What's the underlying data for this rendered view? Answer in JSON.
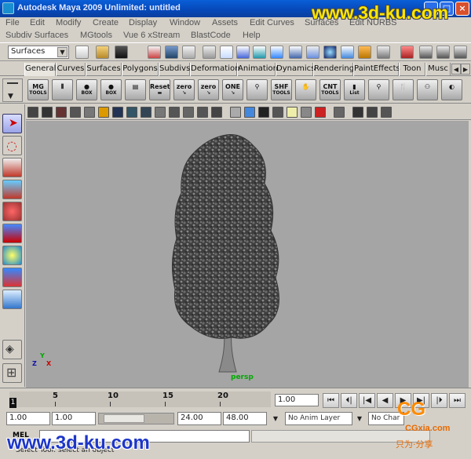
{
  "window": {
    "title": "Autodesk Maya 2009 Unlimited: untitled",
    "minimize": "_",
    "maximize": "□",
    "close": "×"
  },
  "menus": {
    "row1": [
      "File",
      "Edit",
      "Modify",
      "Create",
      "Display",
      "Window",
      "Assets",
      "Edit Curves",
      "Surfaces",
      "Edit NURBS"
    ],
    "row2": [
      "Subdiv Surfaces",
      "MGtools",
      "Vue 6 xStream",
      "BlastCode",
      "Help"
    ]
  },
  "toolbar": {
    "mode_selector": "Surfaces"
  },
  "shelf": {
    "tabs": [
      "General",
      "Curves",
      "Surfaces",
      "Polygons",
      "Subdivs",
      "Deformation",
      "Animation",
      "Dynamics",
      "Rendering",
      "PaintEffects",
      "Toon",
      "Musc"
    ],
    "active_tab": "General",
    "buttons": [
      {
        "l1": "MG",
        "l2": "TOOLS"
      },
      {
        "l1": "⦀",
        "l2": ""
      },
      {
        "l1": "●",
        "l2": "BOX"
      },
      {
        "l1": "●",
        "l2": "BOX"
      },
      {
        "l1": "▤",
        "l2": ""
      },
      {
        "l1": "Reset",
        "l2": "▬"
      },
      {
        "l1": "zero",
        "l2": "↘"
      },
      {
        "l1": "zero",
        "l2": "↘"
      },
      {
        "l1": "ONE",
        "l2": "↘"
      },
      {
        "l1": "⚲",
        "l2": ""
      },
      {
        "l1": "SHF",
        "l2": "TOOLS"
      },
      {
        "l1": "✋",
        "l2": ""
      },
      {
        "l1": "CNT",
        "l2": "TOOLS"
      },
      {
        "l1": "▮",
        "l2": "List"
      },
      {
        "l1": "⚲",
        "l2": ""
      },
      {
        "l1": "🍴",
        "l2": ""
      },
      {
        "l1": "⚇",
        "l2": ""
      },
      {
        "l1": "◐",
        "l2": ""
      }
    ]
  },
  "viewport": {
    "camera": "persp",
    "axis_x": "X",
    "axis_y": "Y",
    "axis_z": "Z"
  },
  "timeline": {
    "tick_labels": [
      "1",
      "5",
      "10",
      "15",
      "20"
    ],
    "current_frame": "1",
    "current_frame_field": "1.00",
    "playback_buttons": [
      "⏮",
      "⏴|",
      "|◀",
      "◀",
      "▶",
      "▶|",
      "|⏵",
      "⏭"
    ]
  },
  "range": {
    "start_min": "1.00",
    "start": "1.00",
    "end": "24.00",
    "end_max": "48.00",
    "anim_layer": "No Anim Layer",
    "character": "No Char"
  },
  "command_line": {
    "label": "MEL",
    "input": "",
    "help": "Select Tool: select an object"
  },
  "watermarks": {
    "top": "www.3d-ku.com",
    "bottom": "www.3d-ku.com",
    "cg": "CG",
    "cgxia": "CGxia.com",
    "cgsub": "只为·分享"
  }
}
